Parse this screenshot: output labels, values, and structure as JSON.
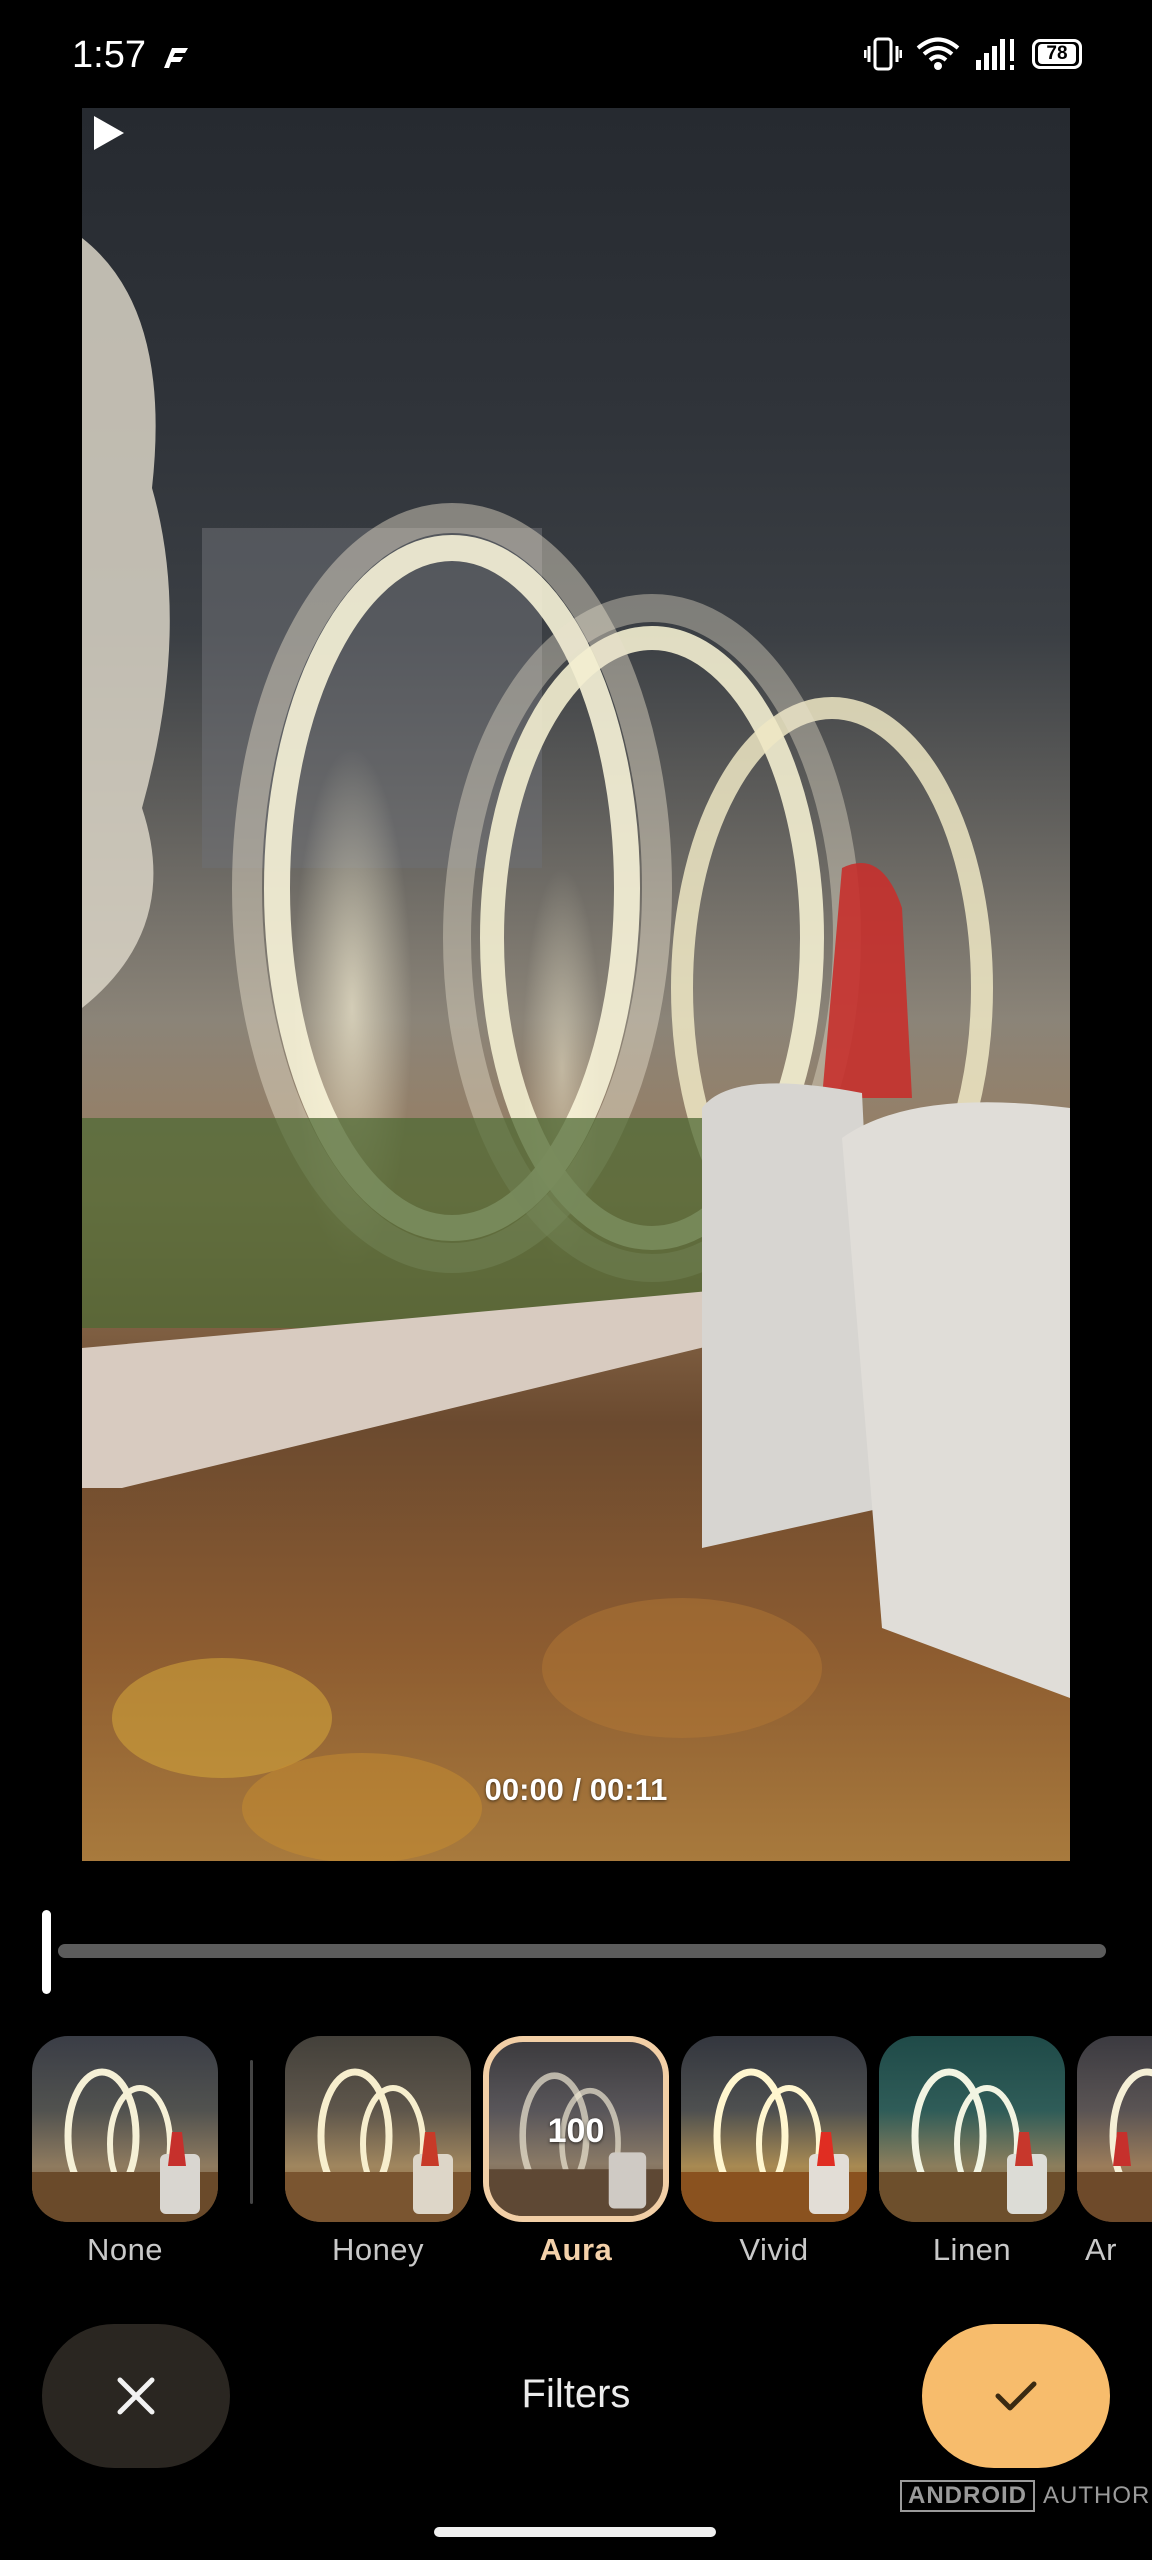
{
  "status_bar": {
    "time": "1:57",
    "battery": "78",
    "icons": [
      "app-notification-icon",
      "vibrate-icon",
      "wifi-icon",
      "signal-icon",
      "battery-icon"
    ]
  },
  "video": {
    "timecode": "00:00 / 00:11",
    "play_icon": "play-icon",
    "progress": 0
  },
  "filters": {
    "items": [
      {
        "label": "None",
        "selected": false
      },
      {
        "label": "Honey",
        "selected": false
      },
      {
        "label": "Aura",
        "selected": true,
        "value": "100"
      },
      {
        "label": "Vivid",
        "selected": false
      },
      {
        "label": "Linen",
        "selected": false
      },
      {
        "label": "Ar",
        "selected": false
      }
    ]
  },
  "bottom_bar": {
    "title": "Filters",
    "cancel_icon": "close-icon",
    "confirm_icon": "check-icon"
  },
  "watermark": {
    "boxed": "ANDROID",
    "plain": "AUTHORITY"
  },
  "colors": {
    "accent": "#f7bc6c",
    "selected_ring": "#f2cfa6",
    "cancel_bg": "#2a2621",
    "background": "#000000"
  }
}
